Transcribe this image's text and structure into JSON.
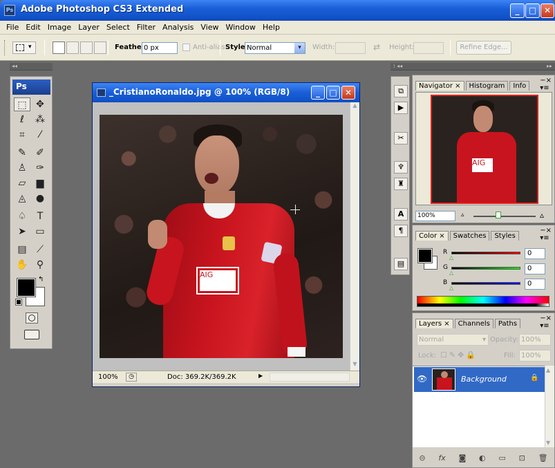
{
  "app": {
    "title": "Adobe Photoshop CS3 Extended",
    "icon_label": "Ps"
  },
  "menu": [
    "File",
    "Edit",
    "Image",
    "Layer",
    "Select",
    "Filter",
    "Analysis",
    "View",
    "Window",
    "Help"
  ],
  "options": {
    "feather_label": "Feather:",
    "feather_value": "0 px",
    "antialias_label": "Anti-alias",
    "style_label": "Style:",
    "style_value": "Normal",
    "width_label": "Width:",
    "height_label": "Height:",
    "refine_edge": "Refine Edge..."
  },
  "tools_logo": "Ps",
  "document": {
    "title": "_CristianoRonaldo.jpg @ 100% (RGB/8)",
    "zoom": "100%",
    "doc_size": "Doc: 369.2K/369.2K",
    "jersey_text": "AIG"
  },
  "navigator": {
    "tabs": [
      "Navigator",
      "Histogram",
      "Info"
    ],
    "zoom": "100%"
  },
  "color_panel": {
    "tabs": [
      "Color",
      "Swatches",
      "Styles"
    ],
    "r_label": "R",
    "g_label": "G",
    "b_label": "B",
    "r_value": "0",
    "g_value": "0",
    "b_value": "0"
  },
  "layers": {
    "tabs": [
      "Layers",
      "Channels",
      "Paths"
    ],
    "blend_mode": "Normal",
    "opacity_label": "Opacity:",
    "opacity_value": "100%",
    "lock_label": "Lock:",
    "fill_label": "Fill:",
    "fill_value": "100%",
    "layer_name": "Background"
  },
  "colors": {
    "xp_blue": "#1a5fd8",
    "panel_bg": "#d4d0c8",
    "workspace": "#6b6b6b",
    "jersey_red": "#c8141e",
    "layer_selected": "#3169c6"
  }
}
